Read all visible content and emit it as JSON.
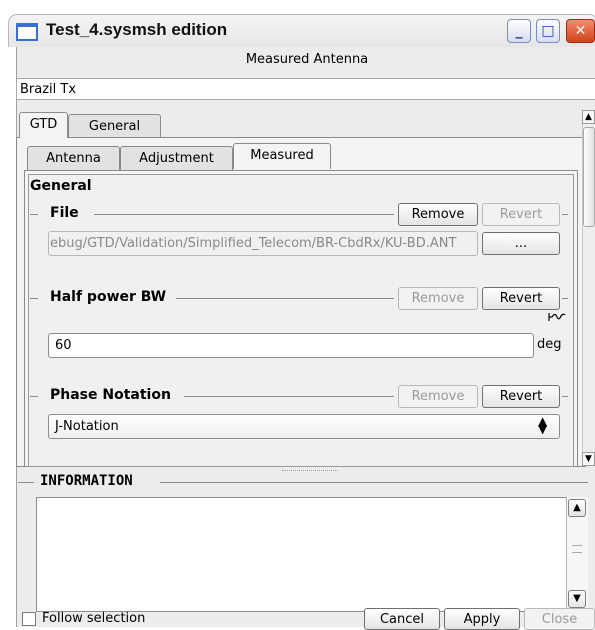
{
  "window": {
    "title": "Test_4.sysmsh edition",
    "minimize_glyph": "_",
    "maximize_glyph": "□",
    "close_glyph": "✕"
  },
  "header": {
    "label": "Measured Antenna"
  },
  "name_field": {
    "value": "Brazil Tx"
  },
  "outer_tabs": [
    {
      "label": "GTD",
      "active": true
    },
    {
      "label": "General",
      "active": false
    }
  ],
  "inner_tabs": [
    {
      "label": "Antenna",
      "active": false
    },
    {
      "label": "Adjustment",
      "active": false
    },
    {
      "label": "Measured",
      "active": true
    }
  ],
  "measured": {
    "section_title": "General",
    "file": {
      "title": "File",
      "remove_label": "Remove",
      "revert_label": "Revert",
      "path": "ebug/GTD/Validation/Simplified_Telecom/BR-CbdRx/KU-BD.ANT",
      "browse_label": "..."
    },
    "half_power_bw": {
      "title": "Half power BW",
      "remove_label": "Remove",
      "revert_label": "Revert",
      "value": "60",
      "unit": "deg"
    },
    "phase_notation": {
      "title": "Phase Notation",
      "remove_label": "Remove",
      "revert_label": "Revert",
      "selected": "J-Notation"
    }
  },
  "information": {
    "title": "INFORMATION"
  },
  "footer": {
    "follow_selection_label": "Follow selection",
    "cancel_label": "Cancel",
    "apply_label": "Apply",
    "close_label": "Close"
  },
  "colors": {
    "title_accent": "#3a6fd0",
    "close_button": "#d2421c",
    "disabled_text": "#9a9a9a"
  }
}
